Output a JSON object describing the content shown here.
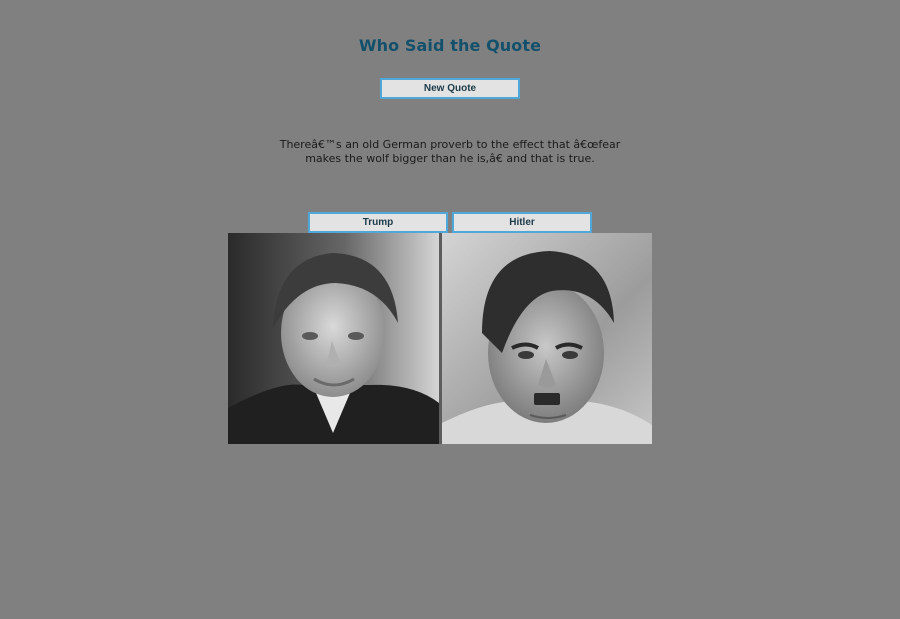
{
  "page": {
    "title": "Who Said the Quote"
  },
  "controls": {
    "new_quote_label": "New Quote"
  },
  "quote": {
    "line1": "Thereâ€™s an old German proverb to the effect that â€œfear",
    "line2": "makes the wolf bigger than he is,â€ and that is true."
  },
  "choices": [
    {
      "label": "Trump"
    },
    {
      "label": "Hitler"
    }
  ],
  "colors": {
    "background": "#808080",
    "title": "#12506b",
    "button_border": "#4fa8d8",
    "button_fill": "#e3e3e3"
  }
}
